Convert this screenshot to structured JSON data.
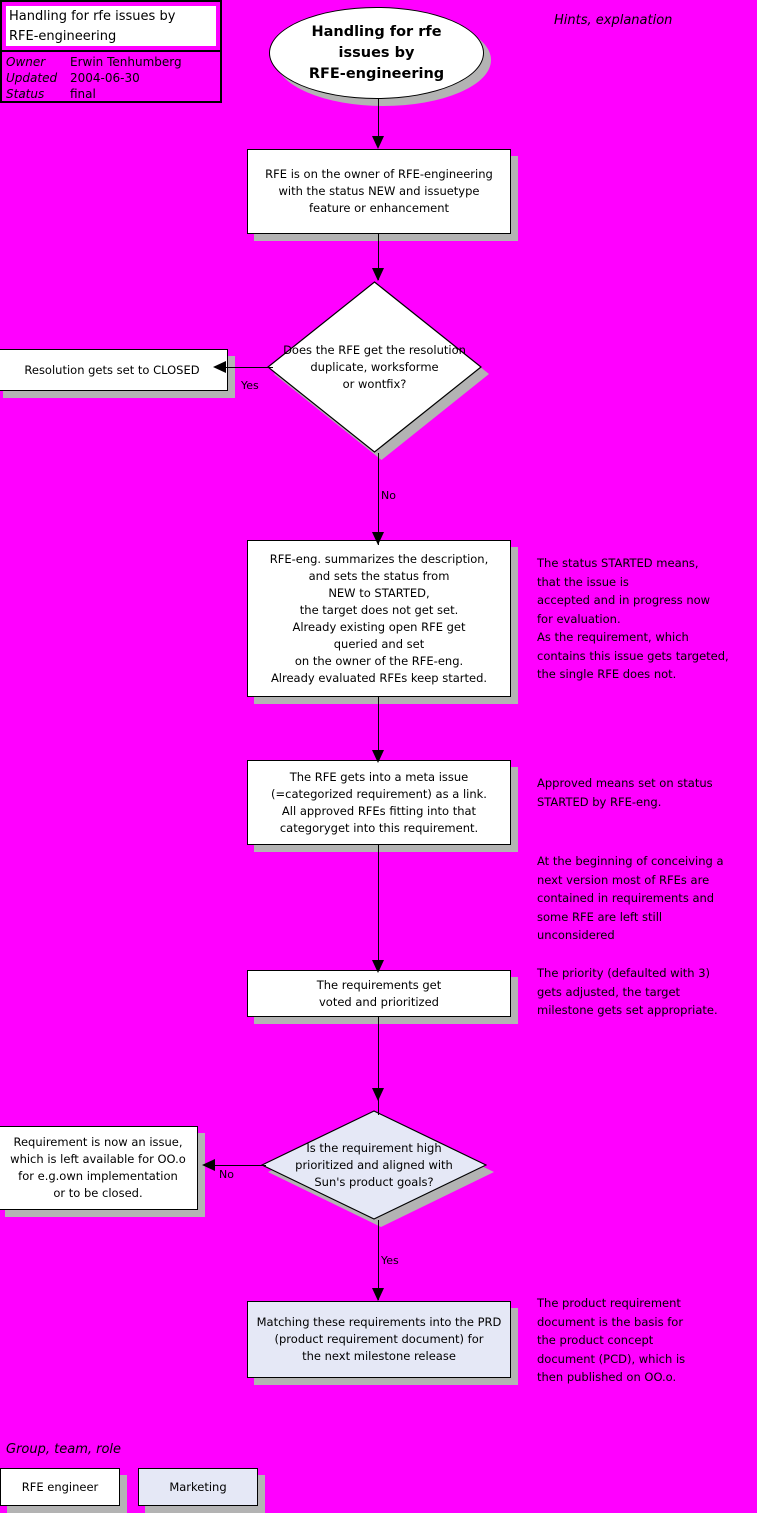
{
  "meta": {
    "background_color": "#ff00ff",
    "shadow_color": "#b3b3b3",
    "fill_white": "#ffffff",
    "fill_lavender": "#e5e8f6",
    "stroke_color": "#000000"
  },
  "header": {
    "title": "Handling for rfe issues by\nRFE-engineering",
    "rows": [
      {
        "key": "Owner",
        "value": "Erwin Tenhumberg"
      },
      {
        "key": "Updated",
        "value": "2004-06-30"
      },
      {
        "key": "Status",
        "value": "final"
      }
    ]
  },
  "section_labels": {
    "hints_header": "Hints, explanation",
    "group_header": "Group, team, role"
  },
  "flow": {
    "start": {
      "label": "Handling for rfe\nissues by\nRFE-engineering",
      "shape": "oval"
    },
    "step_rfe_owner": {
      "label": "RFE is on the owner of RFE-engineering\nwith the status NEW and issuetype\nfeature or enhancement",
      "shape": "process",
      "fill": "white"
    },
    "decision_resolution": {
      "label": "Does the RFE get the resolution\nduplicate, worksforme\nor wontfix?",
      "shape": "decision",
      "fill": "white",
      "yes_label": "Yes",
      "no_label": "No"
    },
    "step_closed": {
      "label": "Resolution gets set to CLOSED",
      "shape": "process",
      "fill": "white"
    },
    "step_summarize": {
      "label": "RFE-eng. summarizes the description,\nand sets the status from\nNEW to STARTED,\nthe target does not get set.\nAlready existing open RFE get\nqueried and set\non the owner of the RFE-eng.\nAlready evaluated RFEs keep started.",
      "shape": "process",
      "fill": "white"
    },
    "step_meta_issue": {
      "label": "The RFE gets into a meta issue\n(=categorized requirement) as a link.\nAll approved RFEs fitting into that\ncategoryget into this requirement.",
      "shape": "process",
      "fill": "white"
    },
    "step_vote": {
      "label": "The requirements get\nvoted and prioritized",
      "shape": "process",
      "fill": "white"
    },
    "decision_priority": {
      "label": "Is the requirement high\nprioritized and aligned with\nSun's product goals?",
      "shape": "decision",
      "fill": "lavender",
      "yes_label": "Yes",
      "no_label": "No"
    },
    "step_requirement_issue": {
      "label": "Requirement is now an issue,\nwhich is left available for OO.o\nfor e.g.own implementation\nor to be closed.",
      "shape": "process",
      "fill": "white"
    },
    "step_prd": {
      "label": "Matching these requirements into the PRD\n(product requirement document) for\nthe next milestone release",
      "shape": "process",
      "fill": "lavender"
    }
  },
  "hints": {
    "started": "The status STARTED means,\nthat the issue is\naccepted and in progress now\nfor evaluation.\nAs the requirement, which\ncontains this issue gets targeted,\nthe single RFE does not.",
    "approved": "Approved means set on status\nSTARTED by RFE-eng.",
    "conceiving": "At the beginning of conceiving a\nnext version most of RFEs are\ncontained in requirements and\nsome RFE are left still\nunconsidered",
    "priority": "The priority (defaulted with 3)\ngets adjusted, the target\nmilestone gets set appropriate.",
    "prd": "The product requirement\ndocument is the basis for\nthe product concept\ndocument (PCD), which is\nthen published on OO.o."
  },
  "legend": {
    "items": [
      {
        "label": "RFE engineer",
        "fill": "white"
      },
      {
        "label": "Marketing",
        "fill": "lavender"
      }
    ]
  }
}
